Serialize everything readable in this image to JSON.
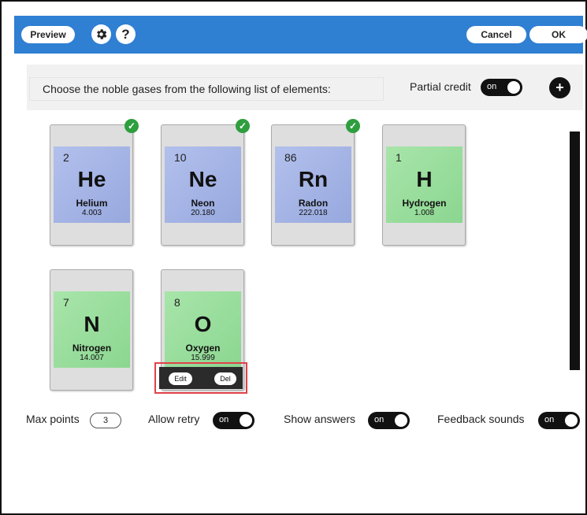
{
  "toolbar": {
    "preview_label": "Preview",
    "gear_icon": "gear-icon",
    "help_label": "?",
    "cancel_label": "Cancel",
    "ok_label": "OK",
    "accent": "#2f7fd3"
  },
  "question": {
    "prompt": "Choose the noble gases from the following list of elements:",
    "partial_credit_label": "Partial credit",
    "partial_credit_toggle": "on",
    "add_label": "+"
  },
  "cards": [
    {
      "number": "2",
      "symbol": "He",
      "name": "Helium",
      "mass": "4.003",
      "selected": true,
      "group": "noble"
    },
    {
      "number": "10",
      "symbol": "Ne",
      "name": "Neon",
      "mass": "20.180",
      "selected": true,
      "group": "noble"
    },
    {
      "number": "86",
      "symbol": "Rn",
      "name": "Radon",
      "mass": "222.018",
      "selected": true,
      "group": "noble"
    },
    {
      "number": "1",
      "symbol": "H",
      "name": "Hydrogen",
      "mass": "1.008",
      "selected": false,
      "group": "other"
    },
    {
      "number": "7",
      "symbol": "N",
      "name": "Nitrogen",
      "mass": "14.007",
      "selected": false,
      "group": "other"
    },
    {
      "number": "8",
      "symbol": "O",
      "name": "Oxygen",
      "mass": "15.999",
      "selected": false,
      "group": "other"
    }
  ],
  "card_toolbar": {
    "edit_label": "Edit",
    "del_label": "Del"
  },
  "settings": {
    "max_points_label": "Max points",
    "max_points_value": "3",
    "allow_retry_label": "Allow retry",
    "allow_retry_toggle": "on",
    "show_answers_label": "Show answers",
    "show_answers_toggle": "on",
    "feedback_sounds_label": "Feedback sounds",
    "feedback_sounds_toggle": "on"
  },
  "colors": {
    "noble_tile": "#a3b3e6",
    "other_tile": "#98dc9c",
    "check": "#2e9e3e",
    "highlight": "#e0424a"
  }
}
